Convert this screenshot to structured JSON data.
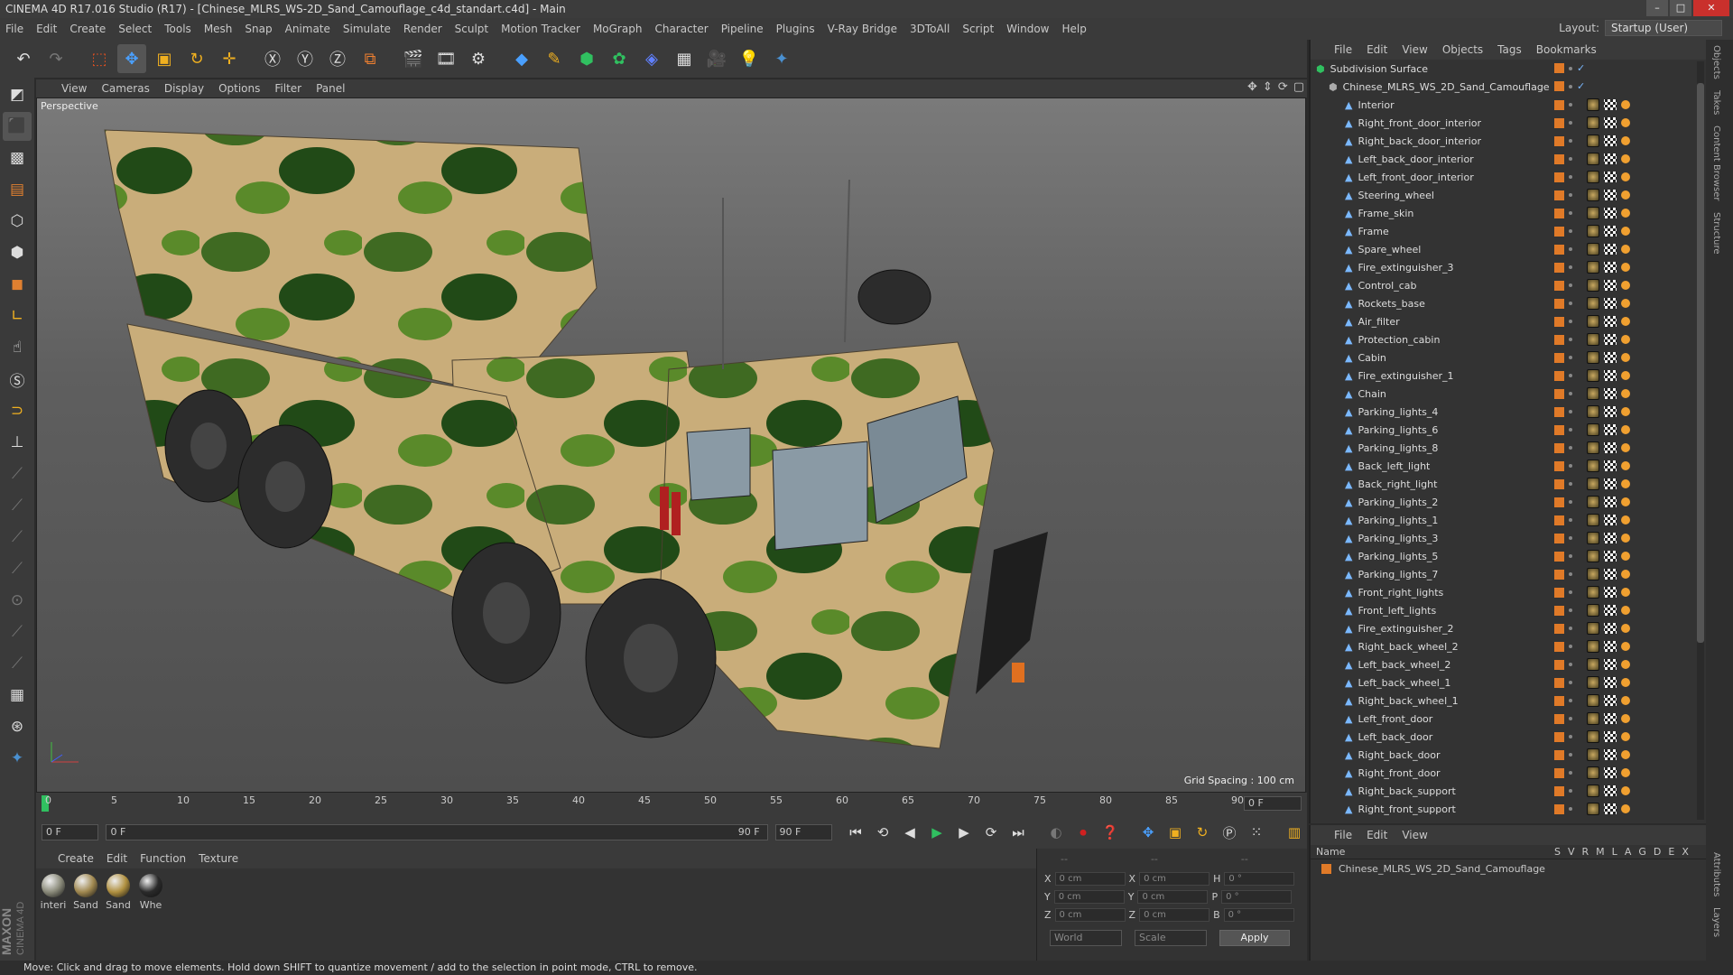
{
  "window": {
    "title": "CINEMA 4D R17.016 Studio (R17) - [Chinese_MLRS_WS-2D_Sand_Camouflage_c4d_standart.c4d] - Main"
  },
  "menu": [
    "File",
    "Edit",
    "Create",
    "Select",
    "Tools",
    "Mesh",
    "Snap",
    "Animate",
    "Simulate",
    "Render",
    "Sculpt",
    "Motion Tracker",
    "MoGraph",
    "Character",
    "Pipeline",
    "Plugins",
    "V-Ray Bridge",
    "3DToAll",
    "Script",
    "Window",
    "Help"
  ],
  "layout": {
    "label": "Layout:",
    "value": "Startup (User)"
  },
  "viewport": {
    "menu": [
      "View",
      "Cameras",
      "Display",
      "Options",
      "Filter",
      "Panel"
    ],
    "label": "Perspective",
    "grid_spacing": "Grid Spacing : 100 cm"
  },
  "timeline": {
    "ticks": [
      "0",
      "5",
      "10",
      "15",
      "20",
      "25",
      "30",
      "35",
      "40",
      "45",
      "50",
      "55",
      "60",
      "65",
      "70",
      "75",
      "80",
      "85",
      "90"
    ],
    "current_frame": "0 F"
  },
  "transport": {
    "start": "0 F",
    "range_start": "0 F",
    "range_end": "90 F",
    "end": "90 F"
  },
  "materials": {
    "menu": [
      "Create",
      "Edit",
      "Function",
      "Texture"
    ],
    "items": [
      {
        "label": "interi",
        "color": "#8a8a7a"
      },
      {
        "label": "Sand",
        "color": "#a08850"
      },
      {
        "label": "Sand",
        "color": "#b09040"
      },
      {
        "label": "Whe",
        "color": "#2a2a2a"
      }
    ]
  },
  "coords": {
    "header": [
      "--",
      "--",
      "--"
    ],
    "rows": [
      {
        "a": "X",
        "av": "0 cm",
        "b": "X",
        "bv": "0 cm",
        "c": "H",
        "cv": "0 °"
      },
      {
        "a": "Y",
        "av": "0 cm",
        "b": "Y",
        "bv": "0 cm",
        "c": "P",
        "cv": "0 °"
      },
      {
        "a": "Z",
        "av": "0 cm",
        "b": "Z",
        "bv": "0 cm",
        "c": "B",
        "cv": "0 °"
      }
    ],
    "mode": "World",
    "scale": "Scale",
    "apply": "Apply"
  },
  "objects": {
    "menu": [
      "File",
      "Edit",
      "View",
      "Objects",
      "Tags",
      "Bookmarks"
    ],
    "root": "Subdivision Surface",
    "group": "Chinese_MLRS_WS_2D_Sand_Camouflage",
    "children": [
      "Interior",
      "Right_front_door_interior",
      "Right_back_door_interior",
      "Left_back_door_interior",
      "Left_front_door_interior",
      "Steering_wheel",
      "Frame_skin",
      "Frame",
      "Spare_wheel",
      "Fire_extinguisher_3",
      "Control_cab",
      "Rockets_base",
      "Air_filter",
      "Protection_cabin",
      "Cabin",
      "Fire_extinguisher_1",
      "Chain",
      "Parking_lights_4",
      "Parking_lights_6",
      "Parking_lights_8",
      "Back_left_light",
      "Back_right_light",
      "Parking_lights_2",
      "Parking_lights_1",
      "Parking_lights_3",
      "Parking_lights_5",
      "Parking_lights_7",
      "Front_right_lights",
      "Front_left_lights",
      "Fire_extinguisher_2",
      "Right_back_wheel_2",
      "Left_back_wheel_2",
      "Left_back_wheel_1",
      "Right_back_wheel_1",
      "Left_front_door",
      "Left_back_door",
      "Right_back_door",
      "Right_front_door",
      "Right_back_support",
      "Right_front_support"
    ]
  },
  "layers": {
    "menu": [
      "File",
      "Edit",
      "View"
    ],
    "name_header": "Name",
    "cols": [
      "S",
      "V",
      "R",
      "M",
      "L",
      "A",
      "G",
      "D",
      "E",
      "X"
    ],
    "row": "Chinese_MLRS_WS_2D_Sand_Camouflage"
  },
  "side_tabs": [
    "Objects",
    "Takes",
    "Content Browser",
    "Structure"
  ],
  "side_tabs_bottom": [
    "Attributes",
    "Layers"
  ],
  "status": "Move: Click and drag to move elements. Hold down SHIFT to quantize movement / add to the selection in point mode, CTRL to remove.",
  "brand": {
    "maxon": "MAXON",
    "c4d": "CINEMA 4D"
  }
}
